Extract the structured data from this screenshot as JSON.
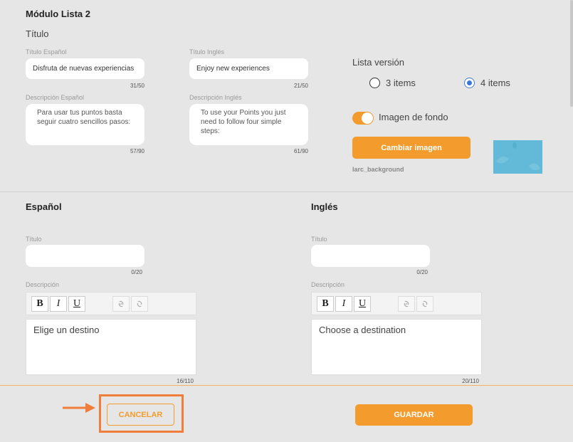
{
  "module": {
    "title": "Módulo Lista 2",
    "titulo_heading": "Título",
    "titulo_es": {
      "label": "Título Español",
      "value": "Disfruta de nuevas experiencias",
      "count": "31/50"
    },
    "titulo_en": {
      "label": "Título Inglés",
      "value": "Enjoy new experiences",
      "count": "21/50"
    },
    "desc_es": {
      "label": "Descripción Español",
      "value": "Para usar tus puntos basta seguir cuatro sencillos pasos:",
      "count": "57/90"
    },
    "desc_en": {
      "label": "Descripción Inglés",
      "value": "To use your Points you just need to follow four simple steps:",
      "count": "61/90"
    },
    "lista_version": {
      "label": "Lista versión",
      "options": [
        "3 items",
        "4 items"
      ],
      "selected": "4 items"
    },
    "background": {
      "label": "Imagen de fondo",
      "enabled": true,
      "change_button": "Cambiar imagen",
      "filename": "larc_background"
    }
  },
  "espanol": {
    "heading": "Español",
    "titulo_label": "Título",
    "titulo_value": "",
    "titulo_count": "0/20",
    "desc_label": "Descripción",
    "editor_text": "Elige un destino",
    "editor_count": "16/110"
  },
  "ingles": {
    "heading": "Inglés",
    "titulo_label": "Título",
    "titulo_value": "",
    "titulo_count": "0/20",
    "desc_label": "Descripción",
    "editor_text": "Choose a destination",
    "editor_count": "20/110"
  },
  "toolbar": {
    "bold": "B",
    "italic": "I",
    "underline": "U",
    "link_icon": "link-icon",
    "unlink_icon": "unlink-icon"
  },
  "footer": {
    "cancel_label": "CANCELAR",
    "save_label": "GUARDAR"
  },
  "colors": {
    "accent": "#f39c2d",
    "highlight": "#f07d3a",
    "radio_selected": "#3a78d8"
  }
}
